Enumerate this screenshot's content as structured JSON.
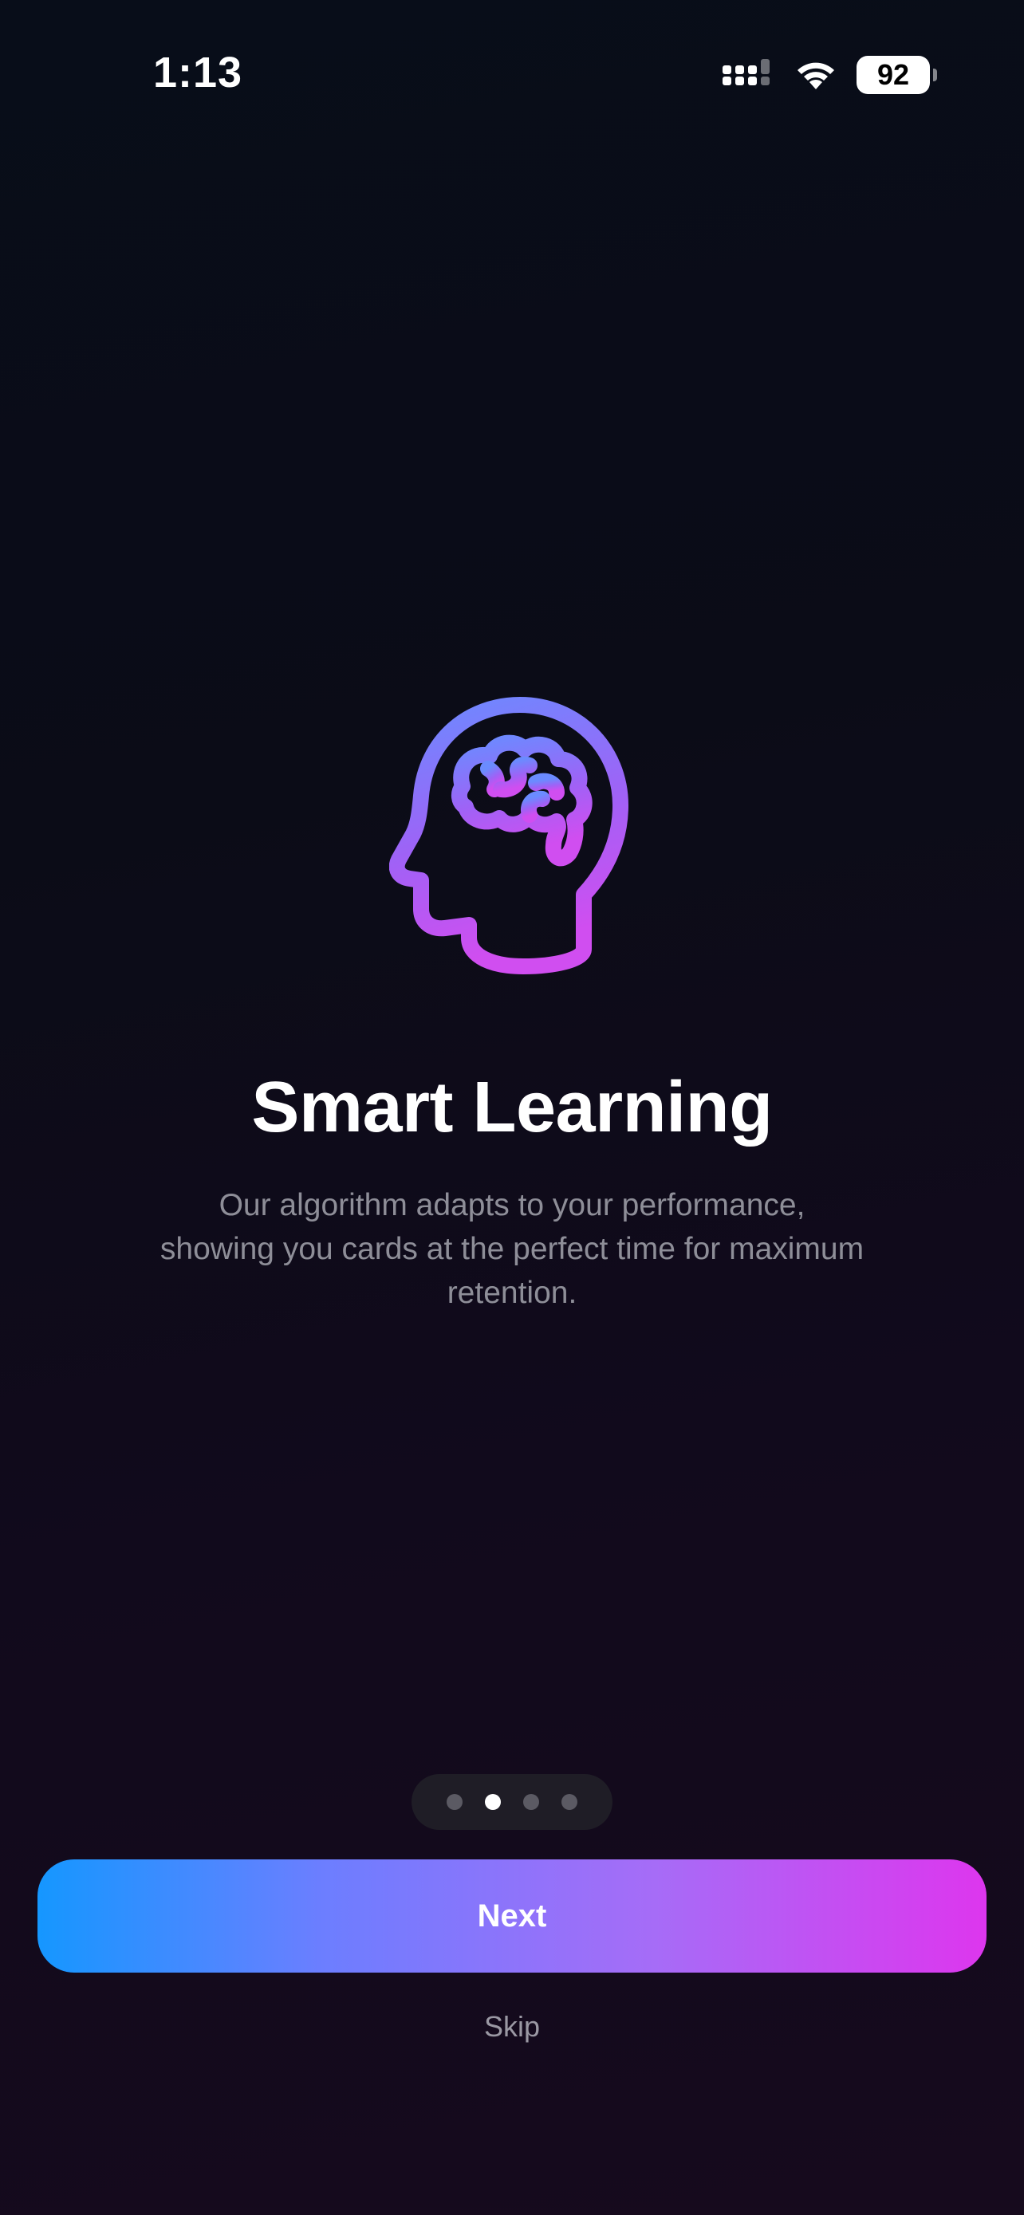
{
  "status_bar": {
    "time": "1:13",
    "battery_level": "92",
    "icons": [
      "cellular-signal-icon",
      "wifi-icon",
      "battery-icon"
    ]
  },
  "onboarding": {
    "icon": "head-brain-icon",
    "title": "Smart Learning",
    "description": "Our algorithm adapts to your performance, showing you cards at the perfect time for maximum retention.",
    "page_indicator": {
      "total_pages": 4,
      "current_page": 2
    },
    "next_label": "Next",
    "skip_label": "Skip"
  },
  "colors": {
    "gradient_start": "#1597ff",
    "gradient_mid": "#a66cf7",
    "gradient_end": "#dd36ee",
    "icon_gradient_top": "#6b8bff",
    "icon_gradient_bottom": "#d04ef0",
    "description_text": "#8e8e98"
  }
}
